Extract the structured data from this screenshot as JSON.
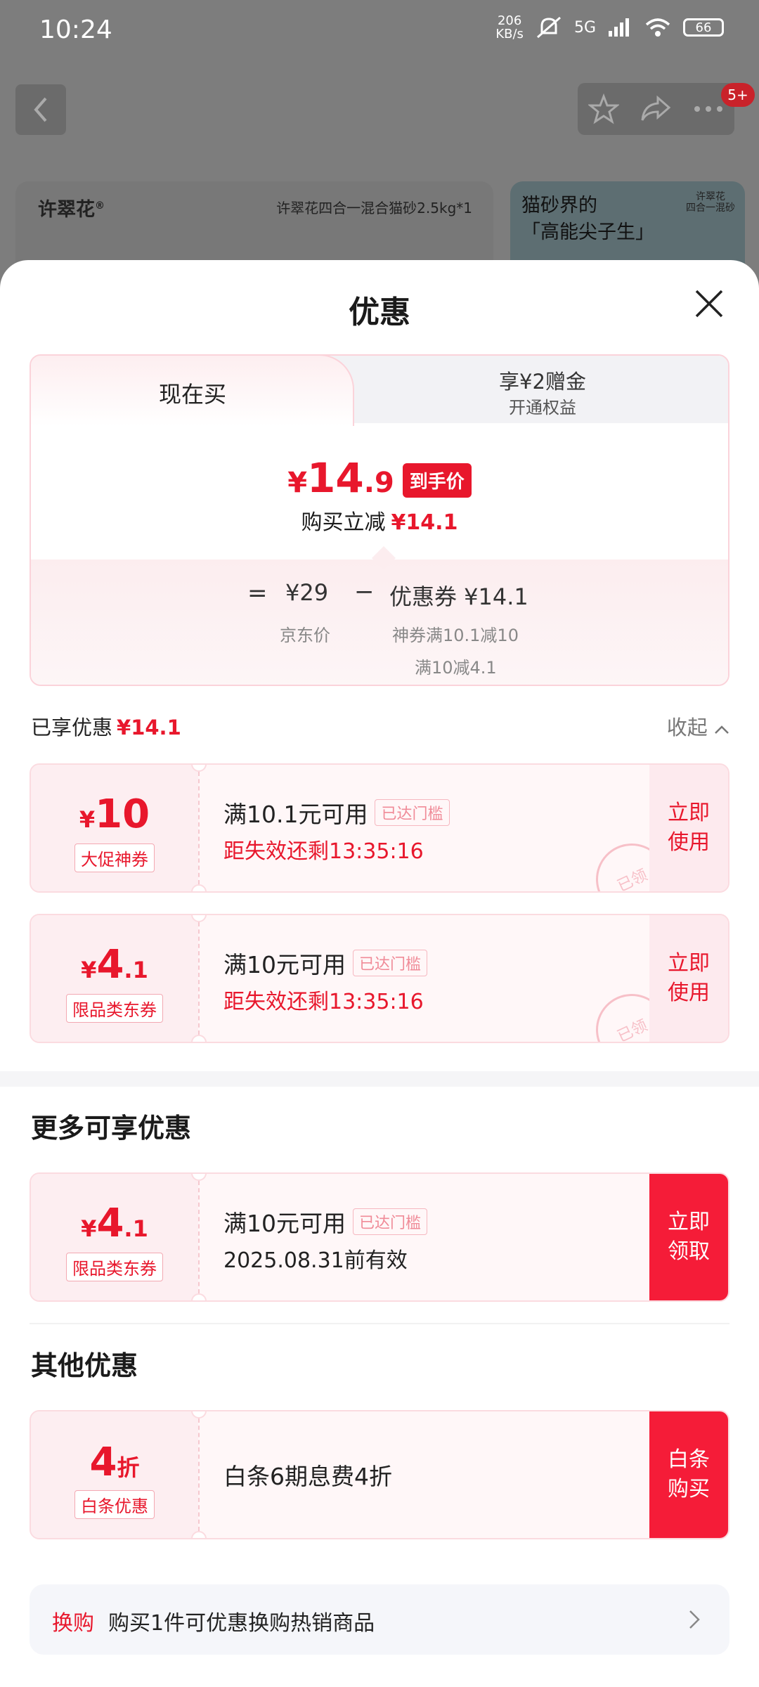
{
  "status_bar": {
    "time": "10:24",
    "net_speed_value": "206",
    "net_speed_unit": "KB/s",
    "signal": "5G",
    "battery": "66"
  },
  "background": {
    "brand": "许翠花",
    "brand_mark": "®",
    "product_title": "许翠花四合一混合猫砂2.5kg*1",
    "slogan_line1": "猫砂界的",
    "slogan_line2": "「高能尖子生」",
    "side_tag_line1": "许翠花",
    "side_tag_line2": "四合一混砂",
    "cart_badge": "5+"
  },
  "sheet": {
    "title": "优惠"
  },
  "price_panel": {
    "tab_now": "现在买",
    "tab_vip_title": "享¥2赠金",
    "tab_vip_sub": "开通权益",
    "final_currency": "¥",
    "final_int": "14",
    "final_dec": ".9",
    "final_badge": "到手价",
    "cut_label": "购买立减",
    "cut_value": "¥14.1",
    "bd_equals": "=",
    "bd_jd_price": "¥29",
    "bd_minus": "−",
    "bd_coupon": "优惠券 ¥14.1",
    "bd_jd_label": "京东价",
    "bd_note1": "神券满10.1减10",
    "bd_note2": "满10减4.1"
  },
  "enjoyed": {
    "label": "已享优惠",
    "value": "¥14.1",
    "collapse": "收起"
  },
  "coupons_applied": [
    {
      "currency": "¥",
      "int": "10",
      "dec": "",
      "tag": "大促神券",
      "condition": "满10.1元可用",
      "reach": "已达门槛",
      "expire": "距失效还剩13:35:16",
      "button": "立即\n使用",
      "stamp": "已领"
    },
    {
      "currency": "¥",
      "int": "4",
      "dec": ".1",
      "tag": "限品类东券",
      "condition": "满10元可用",
      "reach": "已达门槛",
      "expire": "距失效还剩13:35:16",
      "button": "立即\n使用",
      "stamp": "已领"
    }
  ],
  "more": {
    "title": "更多可享优惠",
    "coupon": {
      "currency": "¥",
      "int": "4",
      "dec": ".1",
      "tag": "限品类东券",
      "condition": "满10元可用",
      "reach": "已达门槛",
      "valid": "2025.08.31前有效",
      "button": "立即\n领取"
    }
  },
  "other": {
    "title": "其他优惠",
    "baitiao": {
      "int": "4",
      "unit": "折",
      "tag": "白条优惠",
      "text": "白条6期息费4折",
      "button": "白条\n购买"
    }
  },
  "exchange": {
    "label": "换购",
    "text": "购买1件可优惠换购热销商品"
  },
  "colors": {
    "brand_red": "#e8172c",
    "button_red": "#f51c38",
    "coupon_bg": "#fdeef1"
  }
}
